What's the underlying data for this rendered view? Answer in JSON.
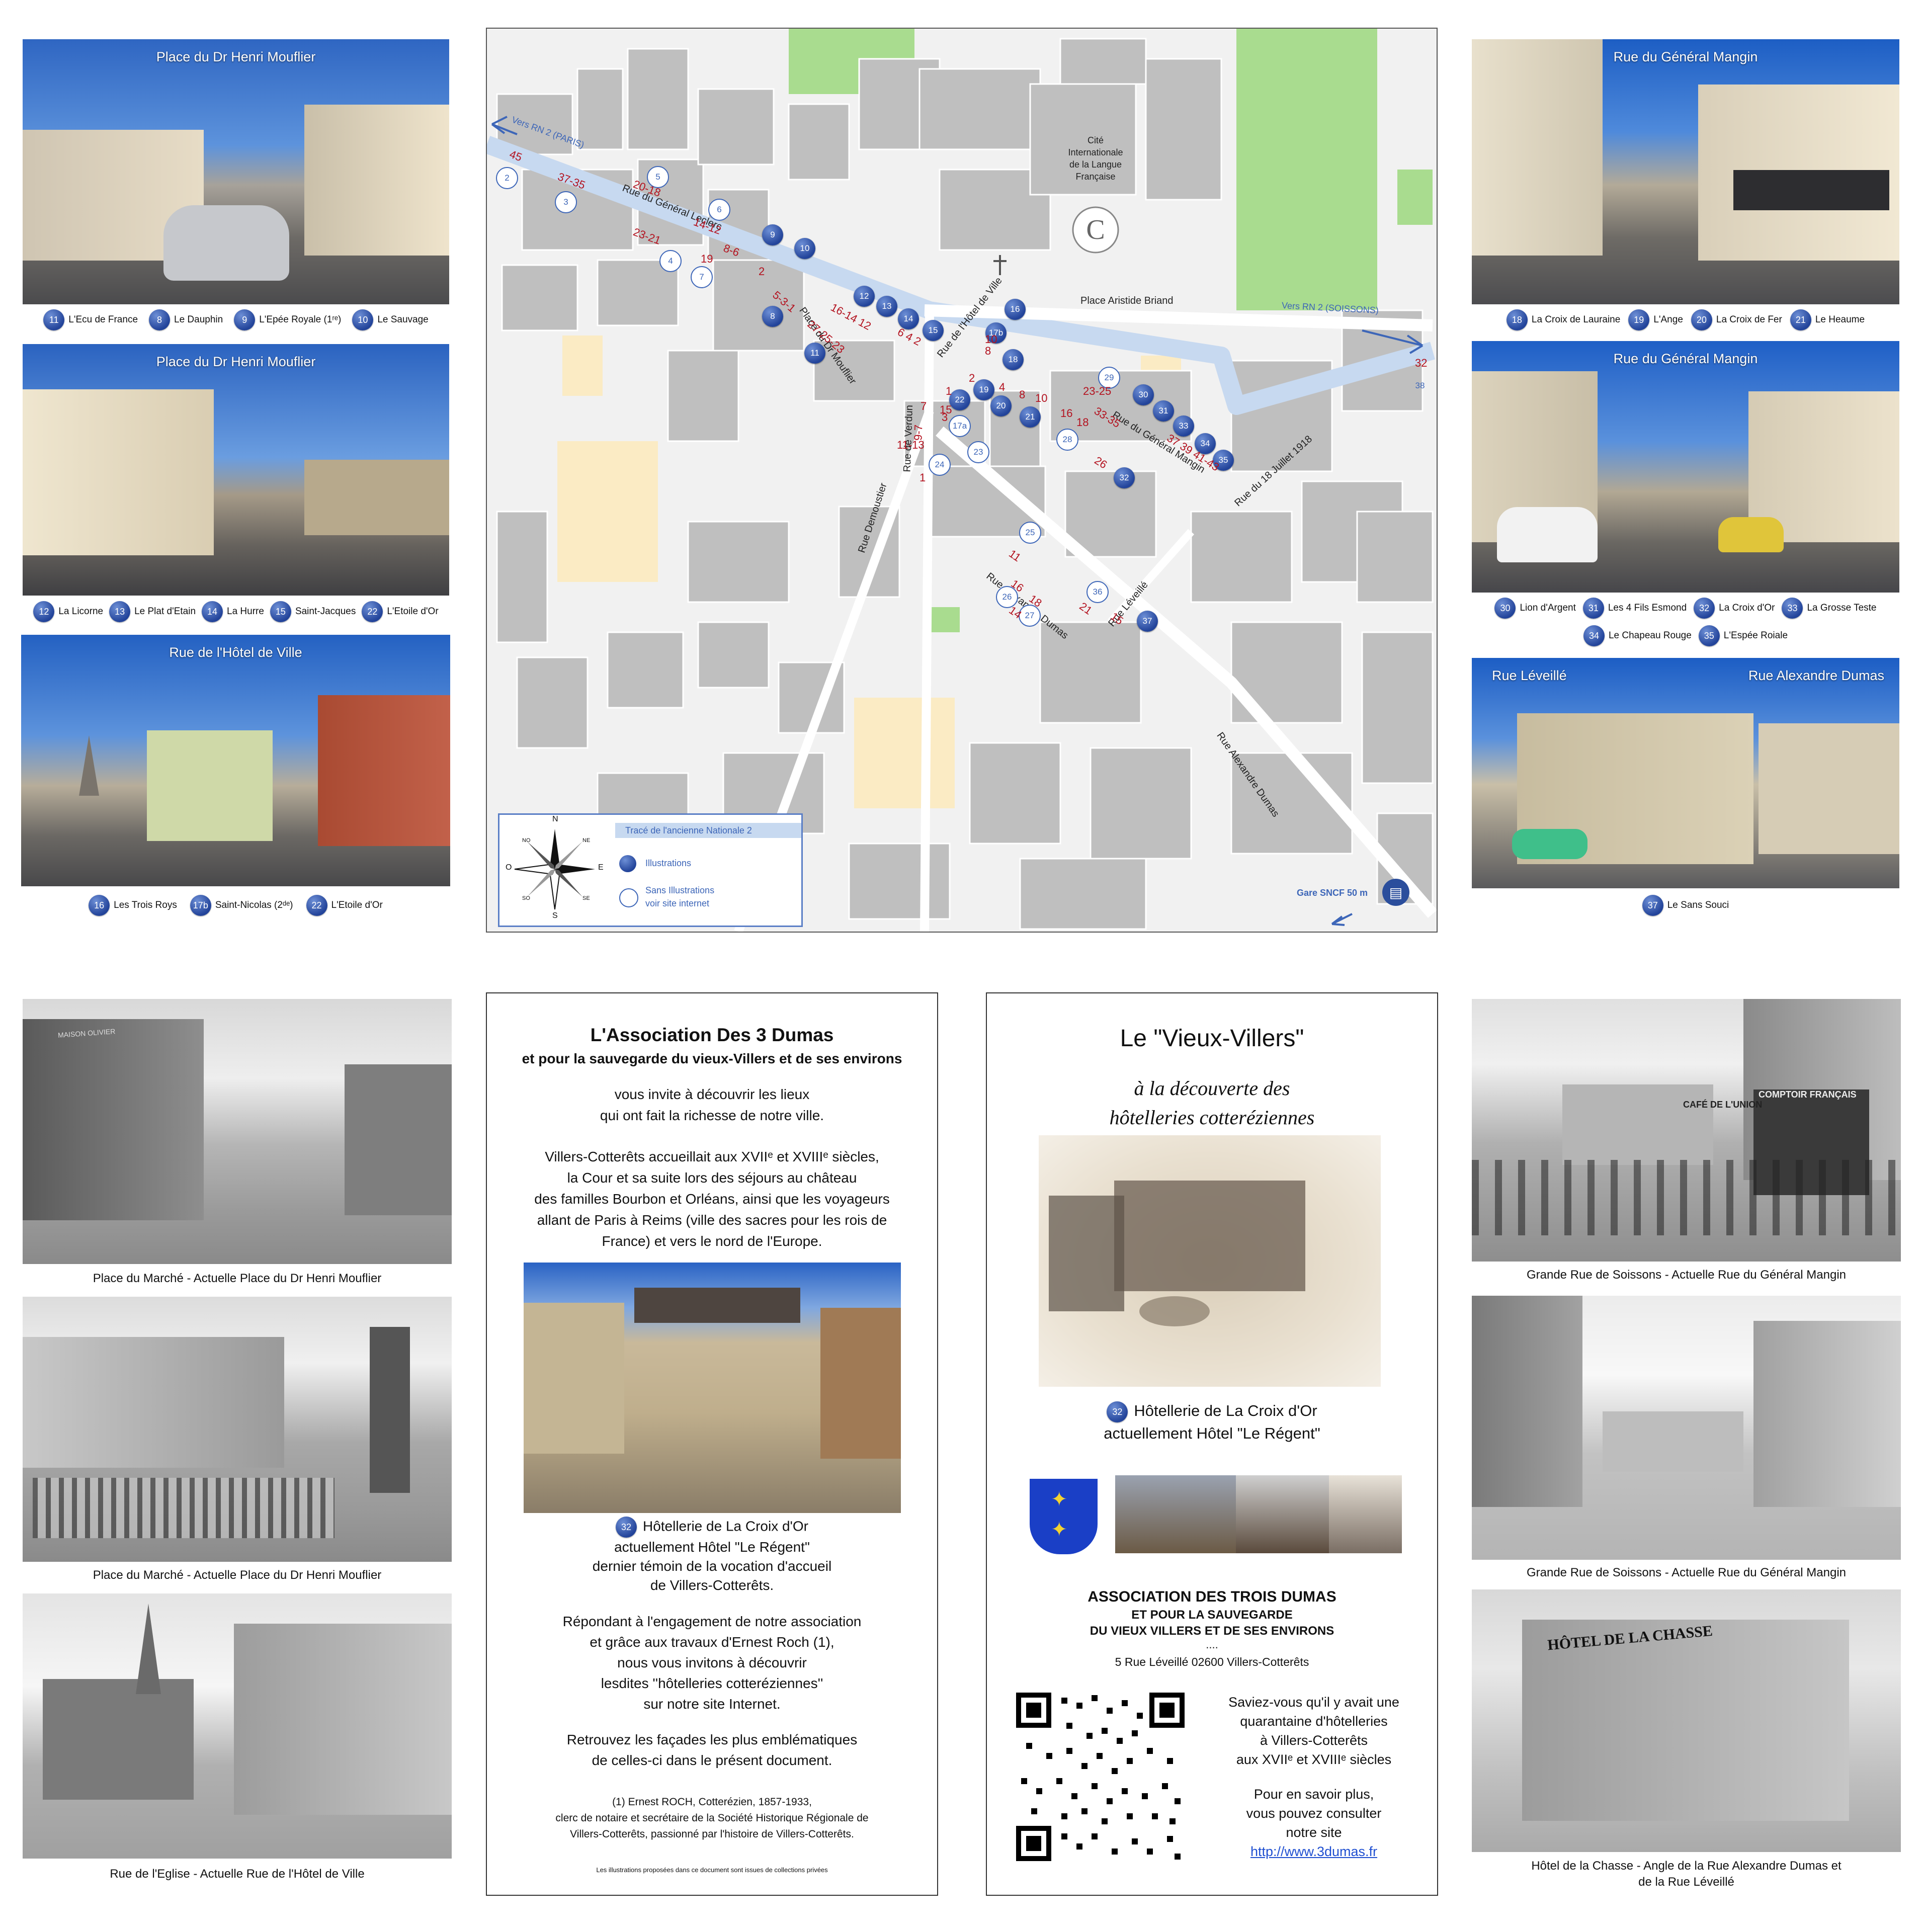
{
  "top_left_photos": [
    {
      "title": "Place du Dr Henri Mouflier",
      "captions": [
        {
          "n": "11",
          "t": "L'Ecu de France"
        },
        {
          "n": "8",
          "t": "Le Dauphin"
        },
        {
          "n": "9",
          "t": "L'Epée Royale (1ʳᵉ)"
        },
        {
          "n": "10",
          "t": "Le Sauvage"
        }
      ]
    },
    {
      "title": "Place du Dr Henri Mouflier",
      "captions": [
        {
          "n": "12",
          "t": "La Licorne"
        },
        {
          "n": "13",
          "t": "Le Plat d'Etain"
        },
        {
          "n": "14",
          "t": "La Hurre"
        },
        {
          "n": "15",
          "t": "Saint-Jacques"
        },
        {
          "n": "22",
          "t": "L'Etoile d'Or"
        }
      ]
    },
    {
      "title": "Rue de l'Hôtel de Ville",
      "captions": [
        {
          "n": "16",
          "t": "Les Trois Roys"
        },
        {
          "n": "17b",
          "t": "Saint-Nicolas (2ᵈᵉ)"
        },
        {
          "n": "22",
          "t": "L'Etoile d'Or"
        }
      ]
    }
  ],
  "top_right_photos": [
    {
      "title": "Rue du Général Mangin",
      "captions": [
        {
          "n": "18",
          "t": "La Croix de Lauraine"
        },
        {
          "n": "19",
          "t": "L'Ange"
        },
        {
          "n": "20",
          "t": "La Croix de Fer"
        },
        {
          "n": "21",
          "t": "Le Heaume"
        }
      ]
    },
    {
      "title": "Rue du Général Mangin",
      "captions": [
        {
          "n": "30",
          "t": "Lion d'Argent"
        },
        {
          "n": "31",
          "t": "Les 4 Fils Esmond"
        },
        {
          "n": "32",
          "t": "La Croix d'Or"
        },
        {
          "n": "33",
          "t": "La Grosse Teste"
        },
        {
          "n": "34",
          "t": "Le Chapeau Rouge"
        },
        {
          "n": "35",
          "t": "L'Espée Roiale"
        }
      ]
    },
    {
      "title_left": "Rue Léveillé",
      "title_right": "Rue Alexandre Dumas",
      "captions": [
        {
          "n": "37",
          "t": "Le Sans Souci"
        }
      ]
    }
  ],
  "map": {
    "labels": {
      "cite": [
        "Cité",
        "Internationale",
        "de la Langue",
        "Française"
      ],
      "rn2_paris": "Vers RN 2 (PARIS)",
      "rn2_soissons": "Vers RN 2 (SOISSONS)",
      "place_briand": "Place Aristide Briand",
      "rue_leclerc": "Rue du Général Leclerc",
      "place_mouflier": "Place du Dr Mouflier",
      "rue_hotel_ville": "Rue de l'Hôtel de Ville",
      "rue_verdun": "Rue de Verdun",
      "rue_demoustier": "Rue Demoustier",
      "rue_mangin": "Rue du Général Mangin",
      "rue_18_juillet": "Rue du 18 Juillet 1918",
      "rue_dumas": "Rue Alexandre Dumas",
      "rue_dumas2": "Rue Alexandre Dumas",
      "rue_leveille": "Rue Léveillé",
      "gare": "Gare SNCF 50 m"
    },
    "legend": {
      "route": "Tracé de l'ancienne Nationale 2",
      "illus": "Illustrations",
      "no_illus_1": "Sans Illustrations",
      "no_illus_2": "voir site internet",
      "N": "N",
      "S": "S",
      "E": "E",
      "O": "O",
      "NE": "NE",
      "NO": "NO",
      "SE": "SE",
      "SO": "SO"
    },
    "filled_badges": [
      "9",
      "10",
      "8",
      "11",
      "12",
      "13",
      "14",
      "15",
      "16",
      "17b",
      "18",
      "19",
      "20",
      "21",
      "22",
      "30",
      "31",
      "33",
      "34",
      "35",
      "32",
      "37"
    ],
    "open_badges": [
      "2",
      "3",
      "5",
      "6",
      "4",
      "7",
      "17a",
      "23",
      "24",
      "25",
      "26",
      "27",
      "28",
      "29",
      "36",
      "38"
    ],
    "house_numbers": [
      "45",
      "37-35",
      "20-18",
      "14-12",
      "8-6",
      "2",
      "23-21",
      "19",
      "16-14 12",
      "6 4 2",
      "5-3-1",
      "27-25-23",
      "10",
      "8",
      "1",
      "2",
      "4",
      "8",
      "10",
      "16",
      "18",
      "23-25",
      "3",
      "9-7",
      "11-13",
      "33-35",
      "37 39 41-43",
      "26",
      "32",
      "11",
      "15",
      "16",
      "21",
      "14",
      "18",
      "15",
      "7",
      "1"
    ]
  },
  "bottom_left_photos": [
    {
      "caption": "Place du Marché - Actuelle Place du Dr Henri Mouflier"
    },
    {
      "caption": "Place du Marché - Actuelle Place du Dr Henri Mouflier"
    },
    {
      "caption": "Rue de l'Eglise - Actuelle Rue de l'Hôtel de Ville"
    }
  ],
  "center_panel": {
    "title": "L'Association Des 3 Dumas",
    "subtitle": "et pour la sauvegarde du vieux-Villers et de ses environs",
    "p1": [
      "vous invite à découvrir les lieux",
      "qui ont fait la richesse de notre ville."
    ],
    "p2": [
      "Villers-Cotterêts accueillait aux XVIIᵉ et XVIIIᵉ siècles,",
      "la Cour et sa suite lors des séjours au château",
      "des familles Bourbon et Orléans, ainsi que les voyageurs",
      "allant de Paris à Reims (ville des sacres pour les rois de",
      "France) et vers le nord de l'Europe."
    ],
    "badge": "32",
    "photo_caption": [
      "Hôtellerie de La Croix d'Or",
      "actuellement  Hôtel \"Le Régent\"",
      "dernier témoin de la vocation d'accueil",
      "de Villers-Cotterêts."
    ],
    "p3": [
      "Répondant à l'engagement de notre association",
      "et grâce aux travaux d'Ernest Roch (1),",
      "nous vous invitons à découvrir",
      "lesdites ''hôtelleries cotteréziennes''",
      "sur notre site Internet."
    ],
    "p4": [
      "Retrouvez les façades les plus emblématiques",
      "de celles-ci dans le présent document."
    ],
    "note": [
      "(1) Ernest ROCH,  Cotterézien, 1857-1933,",
      "clerc de notaire et secrétaire de la Société Historique Régionale de",
      "Villers-Cotterêts, passionné par l'histoire de Villers-Cotterêts."
    ],
    "footer": "Les illustrations proposées dans ce document sont issues de collections privées"
  },
  "cover_panel": {
    "title": "Le \"Vieux-Villers\"",
    "subtitle": [
      "à la découverte des",
      "hôtelleries cotteréziennes"
    ],
    "badge": "32",
    "caption": [
      "Hôtellerie de La Croix d'Or",
      "actuellement  Hôtel \"Le Régent\""
    ],
    "assoc": [
      "ASSOCIATION DES TROIS DUMAS",
      "ET POUR LA SAUVEGARDE",
      "DU VIEUX VILLERS ET DE SES ENVIRONS"
    ],
    "dots": "....",
    "address": "5 Rue Léveillé 02600 Villers-Cotterêts",
    "text1": [
      "Saviez-vous qu'il y avait une",
      "quarantaine d'hôtelleries",
      "à Villers-Cotterêts",
      "aux XVIIᵉ et XVIIIᵉ siècles"
    ],
    "text2": [
      "Pour en savoir plus,",
      "vous pouvez consulter",
      "notre site"
    ],
    "url": "http://www.3dumas.fr"
  },
  "bottom_right_photos": [
    {
      "caption": "Grande Rue de Soissons - Actuelle Rue du Général Mangin"
    },
    {
      "caption": "Grande Rue de Soissons - Actuelle Rue du Général Mangin"
    },
    {
      "caption_1": "Hôtel de la Chasse - Angle de la Rue Alexandre Dumas et",
      "caption_2": "de la Rue Léveillé"
    }
  ],
  "photo_signs": {
    "bw1_sign": "MAISON OLIVIER",
    "bw4_sign": "CAFÉ DE L'UNION",
    "bw4_sign2": "COMPTOIR FRANÇAIS",
    "bw6_sign": "HÔTEL DE LA CHASSE"
  },
  "colors": {
    "badge": "#23449a",
    "route": "#c7d9f0",
    "house_number": "#b3121f",
    "map_bg": "#f1f1f1",
    "building": "#bfbfbf",
    "park": "#a9dc8f",
    "school": "#fbebc4"
  }
}
